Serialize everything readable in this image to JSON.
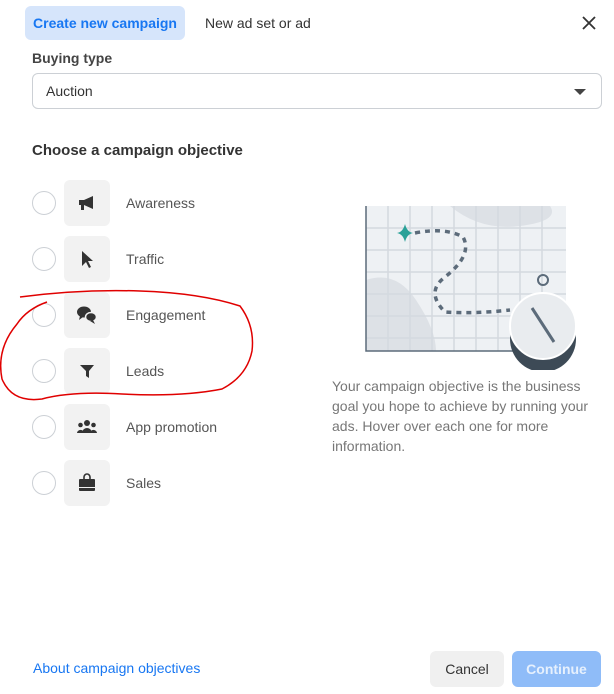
{
  "tabs": {
    "create": "Create new campaign",
    "existing": "New ad set or ad"
  },
  "buying_type": {
    "label": "Buying type",
    "value": "Auction"
  },
  "objective": {
    "heading": "Choose a campaign objective",
    "options": [
      {
        "label": "Awareness",
        "icon": "megaphone-icon"
      },
      {
        "label": "Traffic",
        "icon": "cursor-icon"
      },
      {
        "label": "Engagement",
        "icon": "chat-bubbles-icon"
      },
      {
        "label": "Leads",
        "icon": "funnel-icon"
      },
      {
        "label": "App promotion",
        "icon": "people-icon"
      },
      {
        "label": "Sales",
        "icon": "shopping-bag-icon"
      }
    ],
    "description": "Your campaign objective is the business goal you hope to achieve by running your ads. Hover over each one for more information."
  },
  "footer": {
    "link": "About campaign objectives",
    "cancel": "Cancel",
    "continue": "Continue"
  },
  "colors": {
    "accent": "#1877f2",
    "annotation": "#e00000"
  }
}
